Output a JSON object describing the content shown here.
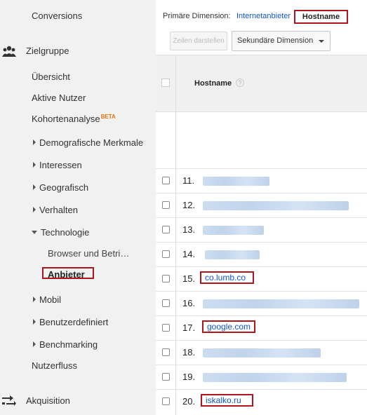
{
  "sidebar": {
    "conversions": "Conversions",
    "audience": "Zielgruppe",
    "items": {
      "overview": "Übersicht",
      "active_users": "Aktive Nutzer",
      "cohort": "Kohortenanalyse",
      "beta": "BETA",
      "demographics": "Demografische Merkmale",
      "interests": "Interessen",
      "geo": "Geografisch",
      "behavior": "Verhalten",
      "technology": "Technologie",
      "browser": "Browser und Betri…",
      "provider": "Anbieter",
      "mobile": "Mobil",
      "custom": "Benutzerdefiniert",
      "benchmarking": "Benchmarking",
      "userflow": "Nutzerfluss"
    },
    "acquisition": "Akquisition",
    "icons": {
      "audience": "users-icon",
      "acquisition": "acquisition-icon"
    }
  },
  "toolbar": {
    "primary_dimension_label": "Primäre Dimension:",
    "dim_provider": "Internetanbieter",
    "dim_hostname": "Hostname",
    "plot_rows": "Zeilen darstellen",
    "secondary_dimension": "Sekundäre Dimension"
  },
  "table": {
    "column": "Hostname",
    "help": "?",
    "rows": [
      {
        "num": "11.",
        "host": ""
      },
      {
        "num": "12.",
        "host": ""
      },
      {
        "num": "13.",
        "host": ""
      },
      {
        "num": "14.",
        "host": ""
      },
      {
        "num": "15.",
        "host": "co.lumb.co"
      },
      {
        "num": "16.",
        "host": ""
      },
      {
        "num": "17.",
        "host": "google.com"
      },
      {
        "num": "18.",
        "host": ""
      },
      {
        "num": "19.",
        "host": ""
      },
      {
        "num": "20.",
        "host": "iskalko.ru"
      }
    ]
  },
  "colors": {
    "highlight": "#b0141c",
    "link": "#1155cc"
  }
}
